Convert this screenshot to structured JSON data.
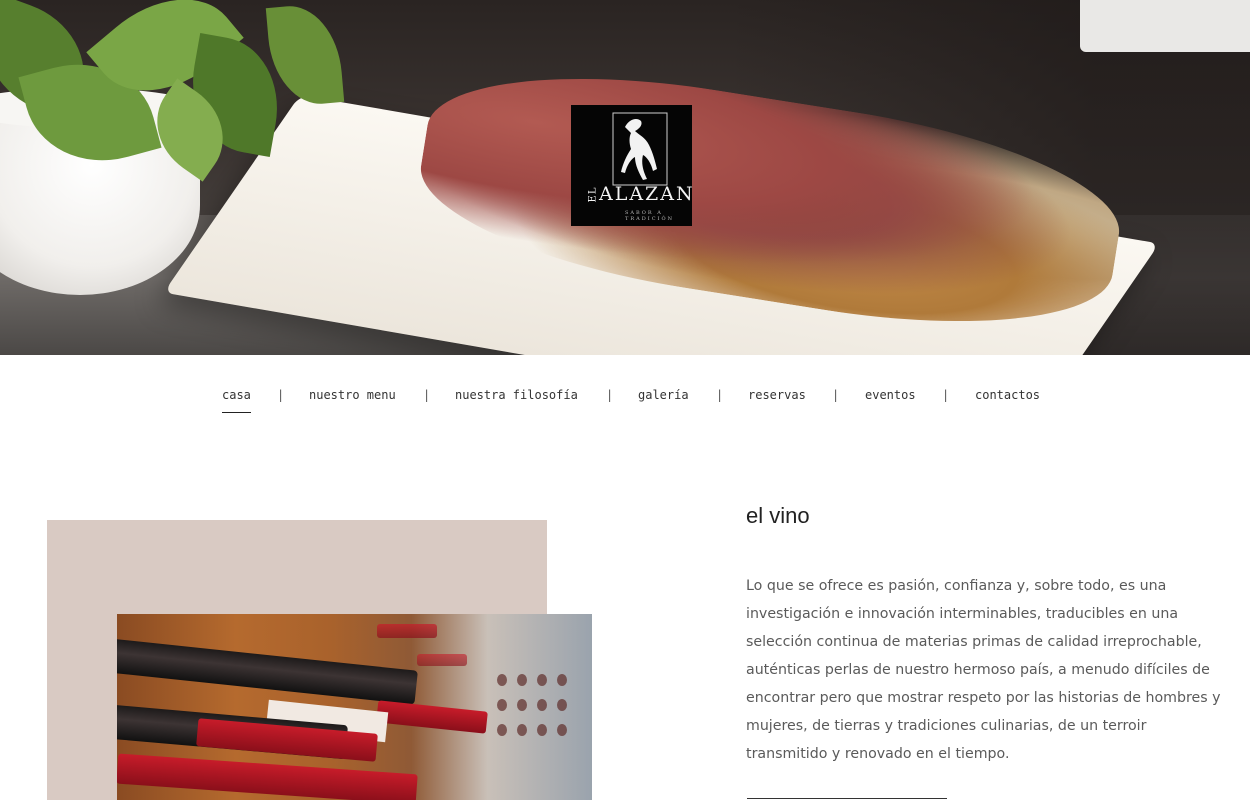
{
  "logo": {
    "prefix": "EL",
    "name": "ALAZAN",
    "tagline": "SABOR A TRADICIÓN"
  },
  "nav": {
    "items": [
      {
        "label": "casa",
        "active": true
      },
      {
        "label": "nuestro menu",
        "active": false
      },
      {
        "label": "nuestra filosofía",
        "active": false
      },
      {
        "label": "galería",
        "active": false
      },
      {
        "label": "reservas",
        "active": false
      },
      {
        "label": "eventos",
        "active": false
      },
      {
        "label": "contactos",
        "active": false
      }
    ],
    "separator": "|"
  },
  "section": {
    "title": "el vino",
    "body": "Lo que se ofrece es pasión, confianza y, sobre todo, es una investigación e innovación interminables, traducibles en una selección continua de materias primas de calidad irreprochable, auténticas perlas de nuestro hermoso país, a menudo difíciles de encontrar pero que mostrar respeto por las historias de hombres y mujeres, de tierras y tradiciones culinarias, de un terroir transmitido y renovado en el tiempo."
  },
  "colors": {
    "accent_block": "#d9cac3",
    "text": "#5a5a5a",
    "logo_bg": "#050505"
  }
}
